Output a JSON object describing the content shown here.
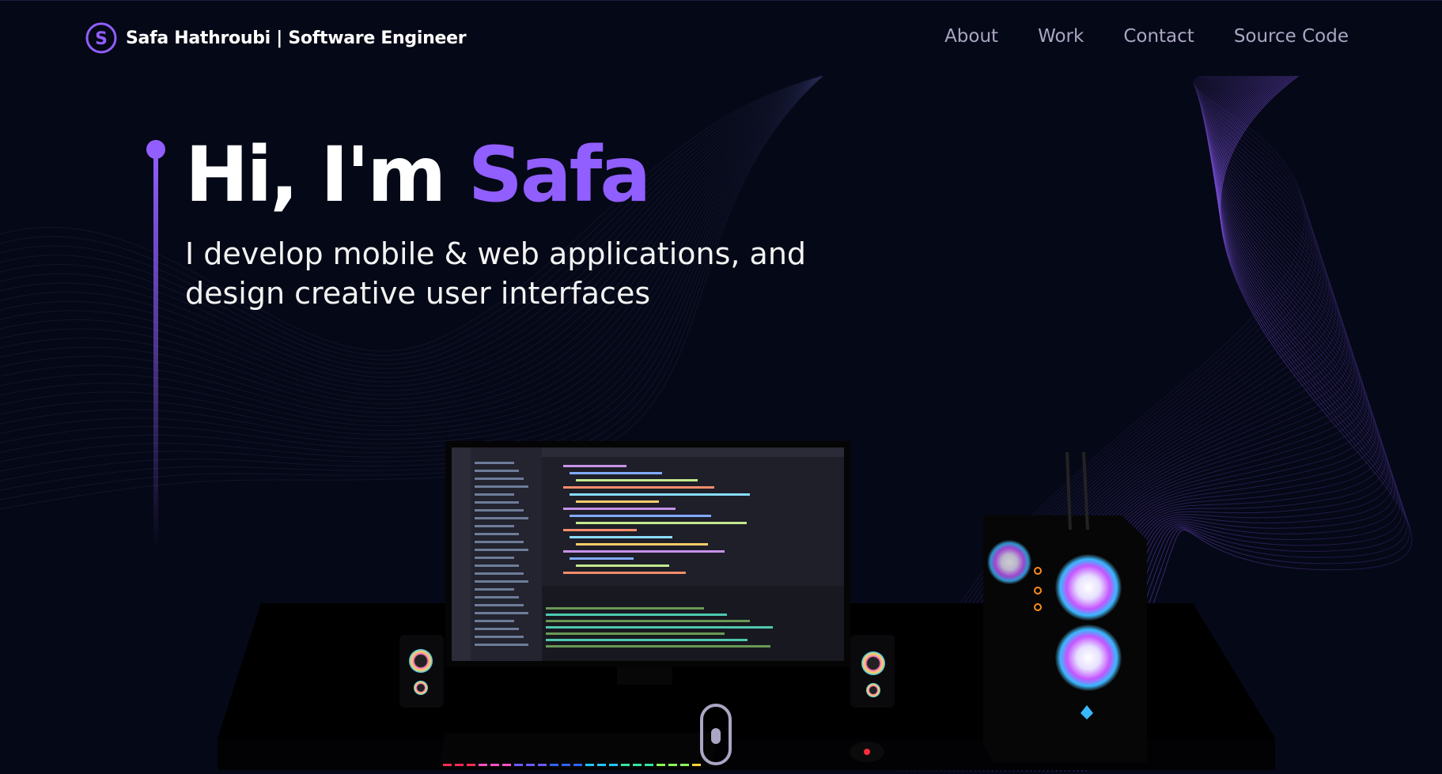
{
  "nav": {
    "logo_letter": "S",
    "brand": "Safa Hathroubi | Software Engineer",
    "links": [
      "About",
      "Work",
      "Contact",
      "Source Code"
    ]
  },
  "hero": {
    "greeting": "Hi, I'm ",
    "name": "Safa",
    "subtitle_line1": "I develop mobile & web applications, and",
    "subtitle_line2": "design creative user interfaces"
  },
  "colors": {
    "background": "#050816",
    "accent": "#915eff",
    "nav_text": "#aaa6c3",
    "white": "#ffffff"
  },
  "icons": [
    "logo-icon",
    "scroll-mouse-icon"
  ]
}
